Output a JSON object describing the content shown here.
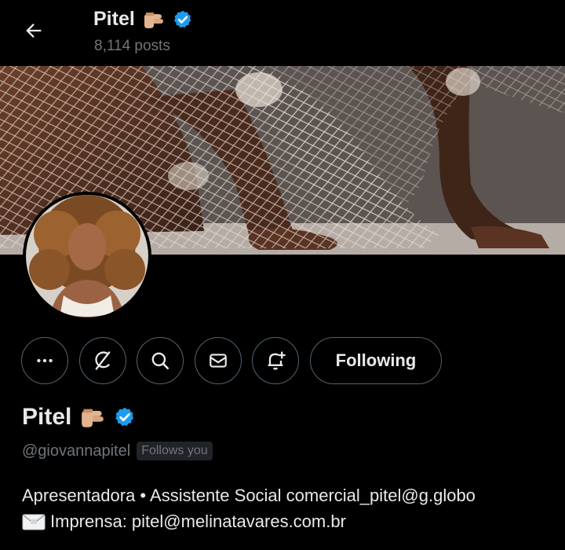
{
  "header": {
    "name": "Pitel",
    "posts": "8,114 posts"
  },
  "actions": {
    "following_label": "Following"
  },
  "profile": {
    "name": "Pitel",
    "handle": "@giovannapitel",
    "follows_you": "Follows you",
    "bio_line1": "Apresentadora • Assistente Social comercial_pitel@g.globo",
    "bio_line2": "Imprensa: pitel@melinatavares.com.br"
  },
  "icons": [
    "back-arrow-icon",
    "pointing-hand-emoji-icon",
    "verified-badge-icon",
    "more-icon",
    "grok-icon",
    "search-icon",
    "message-icon",
    "notification-bell-plus-icon",
    "envelope-emoji-icon"
  ],
  "colors": {
    "background": "#000000",
    "text_primary": "#e7e9ea",
    "text_secondary": "#71767b",
    "verified_blue": "#1d9bf0",
    "border": "#536471"
  }
}
